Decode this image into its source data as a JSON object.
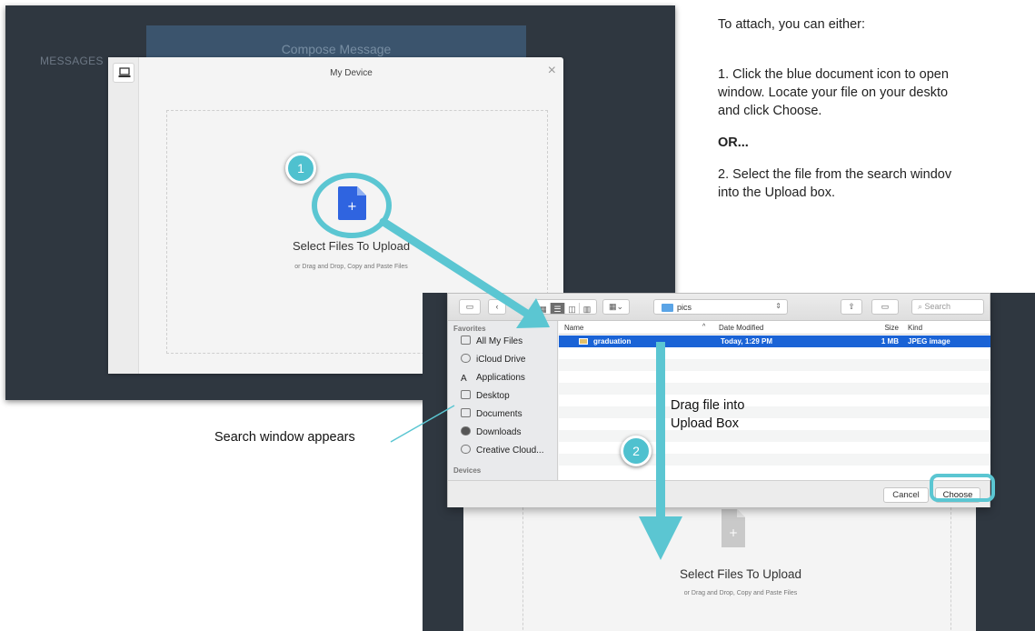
{
  "colors": {
    "accent": "#4fc1cf",
    "app_dark": "#2f3740",
    "doc_blue": "#2f64e0",
    "selection_blue": "#1a63d6"
  },
  "left_shot": {
    "bg_tab_label": "Compose Message",
    "bg_side_label": "MESSAGES",
    "modal": {
      "title": "My Device",
      "close_icon": "close-icon",
      "side_icon": "laptop-icon",
      "dropzone_title": "Select Files To Upload",
      "dropzone_sub": "or Drag and Drop, Copy and Paste Files"
    }
  },
  "instructions": {
    "intro": "To attach, you can either:",
    "step1_line1": "1. Click the blue document icon to open",
    "step1_line2": "window. Locate your file on your deskto",
    "step1_line3": "and click Choose.",
    "or": "OR...",
    "step2_line1": "2. Select the file from the search windov",
    "step2_line2": "into the Upload box."
  },
  "finder": {
    "path": "pics",
    "search_placeholder": "Search",
    "sidebar": {
      "heading": "Favorites",
      "items": [
        {
          "label": "All My Files"
        },
        {
          "label": "iCloud Drive"
        },
        {
          "label": "Applications"
        },
        {
          "label": "Desktop"
        },
        {
          "label": "Documents"
        },
        {
          "label": "Downloads"
        },
        {
          "label": "Creative Cloud..."
        }
      ],
      "heading2": "Devices"
    },
    "columns": [
      "Name",
      "Date Modified",
      "Size",
      "Kind"
    ],
    "files": [
      {
        "name": "graduation",
        "date": "Today, 1:29 PM",
        "size": "1 MB",
        "kind": "JPEG image",
        "selected": true
      }
    ],
    "cancel_label": "Cancel",
    "choose_label": "Choose"
  },
  "right_shot": {
    "dropzone_title": "Select Files To Upload",
    "dropzone_sub": "or Drag and Drop, Copy and Paste Files",
    "add_symbol": "+"
  },
  "annotations": {
    "badge1": "1",
    "badge2": "2",
    "search_callout": "Search window appears",
    "drag_line1": "Drag file into",
    "drag_line2": "Upload Box"
  }
}
